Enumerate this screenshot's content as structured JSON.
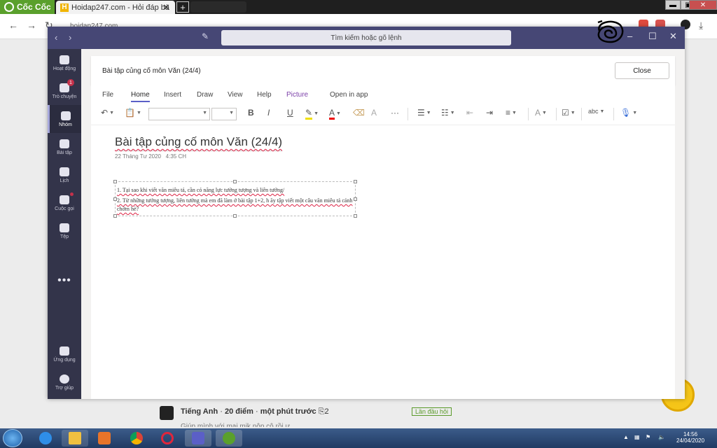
{
  "browser": {
    "brand": "Cốc Cốc",
    "tab_title": "Hoidap247.com - Hỏi đáp bà",
    "tab_close": "✕",
    "new_tab": "+",
    "address": "hoidap247.com",
    "win_min": "▬",
    "win_max": "▣",
    "win_close": "✕"
  },
  "teams": {
    "search_placeholder": "Tìm kiếm hoặc gõ lệnh",
    "rail": [
      {
        "label": "Hoạt động"
      },
      {
        "label": "Trò chuyện",
        "badge": "1"
      },
      {
        "label": "Nhóm"
      },
      {
        "label": "Bài tập"
      },
      {
        "label": "Lịch"
      },
      {
        "label": "Cuộc gọi"
      },
      {
        "label": "Tệp"
      }
    ],
    "rail_more": "•••",
    "rail_bottom": [
      {
        "label": "Ứng dụng"
      },
      {
        "label": "Trợ giúp"
      }
    ]
  },
  "header": {
    "title": "Bài tập củng cố môn Văn (24/4)",
    "close_label": "Close"
  },
  "ribbon": {
    "tabs": [
      "File",
      "Home",
      "Insert",
      "Draw",
      "View",
      "Help",
      "Picture",
      "Open in app"
    ]
  },
  "page": {
    "title": "Bài tập củng cố môn Văn (24/4)",
    "date": "22 Tháng Tư 2020",
    "time": "4:35 CH",
    "line1": "1. Tại sao khi viết văn miêu tả, cần có năng lực tưởng tượng và liên tưởng/",
    "line2": "2. Từ những tưởng tượng, liên tưởng mà em đã làm ở bài tập 1+2, h ãy tập viết một câu văn miêu tả cảnh chớm hè?"
  },
  "behind": {
    "subject": "Tiếng Anh",
    "points": "20 điểm",
    "when": "một phút trước",
    "attach_count": "2",
    "first_time": "Lần đầu hỏi",
    "text": "Giúp mình với mai mik nộp cô rồi ự"
  },
  "taskbar": {
    "time": "14:56",
    "date": "24/04/2020"
  }
}
